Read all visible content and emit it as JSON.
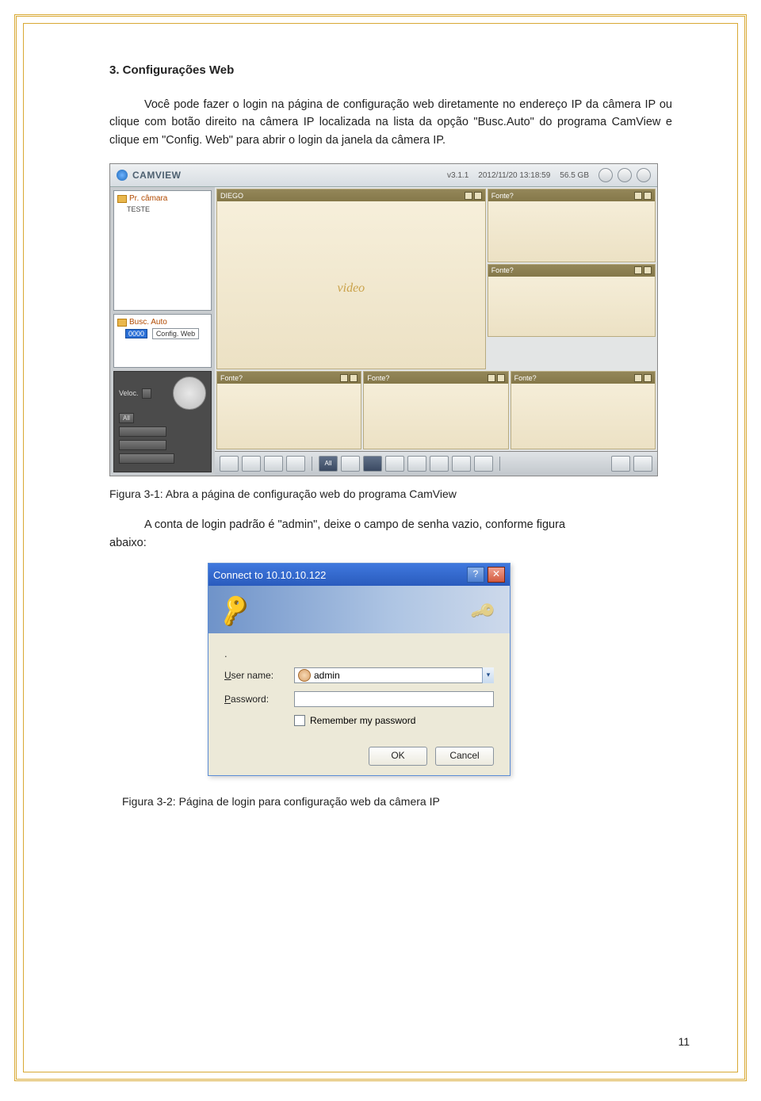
{
  "heading": "3. Configurações Web",
  "para1": "Você pode fazer o login na página de configuração web diretamente no endereço IP da câmera IP ou clique com botão direito na câmera IP localizada na lista da opção \"Busc.Auto\" do programa CamView e clique em \"Config. Web\" para abrir o login da janela da câmera IP.",
  "fig1": "Figura 3-1: Abra a página de configuração web do programa CamView",
  "para2_line": "A conta de login padrão é \"admin\", deixe o campo de senha vazio, conforme figura",
  "para2_tail": "abaixo:",
  "fig2": "Figura 3-2: Página de login para configuração web da câmera IP",
  "page_number": "11",
  "camview": {
    "title": "CAMVIEW",
    "version": "v3.1.1",
    "datetime": "2012/11/20 13:18:59",
    "disk": "56.5 GB",
    "tree_top_title": "Pr. câmara",
    "tree_top_item": "TESTE",
    "tree_bottom_title": "Busc. Auto",
    "highlight_id": "0000",
    "context_item": "Config. Web",
    "tile_big": "DIEGO",
    "tile_label": "Fonte?",
    "video_text": "video",
    "ctrl_label": "Veloc.",
    "btn_all": "All"
  },
  "cred": {
    "title": "Connect to 10.10.10.122",
    "dot": ".",
    "user_label_pre": "U",
    "user_label_rest": "ser name:",
    "pass_label_pre": "P",
    "pass_label_rest": "assword:",
    "user_value": "admin",
    "remember_pre": "R",
    "remember_rest": "emember my password",
    "ok": "OK",
    "cancel": "Cancel"
  }
}
